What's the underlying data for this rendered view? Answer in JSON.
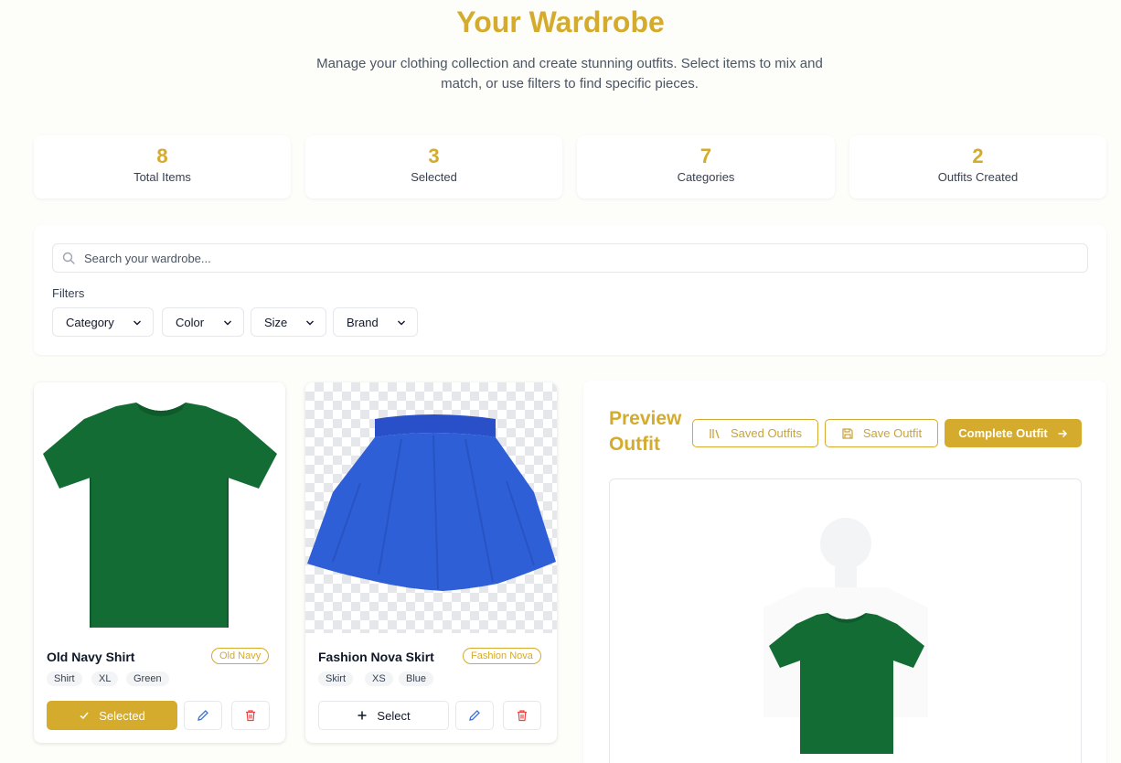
{
  "header": {
    "title": "Your Wardrobe",
    "subtitle": "Manage your clothing collection and create stunning outfits. Select items to mix and match, or use filters to find specific pieces."
  },
  "stats": [
    {
      "value": "8",
      "label": "Total Items"
    },
    {
      "value": "3",
      "label": "Selected"
    },
    {
      "value": "7",
      "label": "Categories"
    },
    {
      "value": "2",
      "label": "Outfits Created"
    }
  ],
  "search": {
    "placeholder": "Search your wardrobe..."
  },
  "filters": {
    "label": "Filters",
    "buttons": [
      "Category",
      "Color",
      "Size",
      "Brand"
    ]
  },
  "items": [
    {
      "name": "Old Navy Shirt",
      "brand": "Old Navy",
      "tags": [
        "Shirt",
        "XL",
        "Green"
      ],
      "selected": true,
      "action_label": "Selected"
    },
    {
      "name": "Fashion Nova Skirt",
      "brand": "Fashion Nova",
      "tags": [
        "Skirt",
        "XS",
        "Blue"
      ],
      "selected": false,
      "action_label": "Select"
    }
  ],
  "preview": {
    "title": "Preview Outfit",
    "saved_outfits_label": "Saved Outfits",
    "save_outfit_label": "Save Outfit",
    "complete_outfit_label": "Complete Outfit"
  },
  "colors": {
    "accent": "#d4ab2c",
    "shirt_green": "#146c35",
    "skirt_blue": "#2f5fd6",
    "delete_red": "#ef4444",
    "edit_blue": "#3b6fd4"
  }
}
